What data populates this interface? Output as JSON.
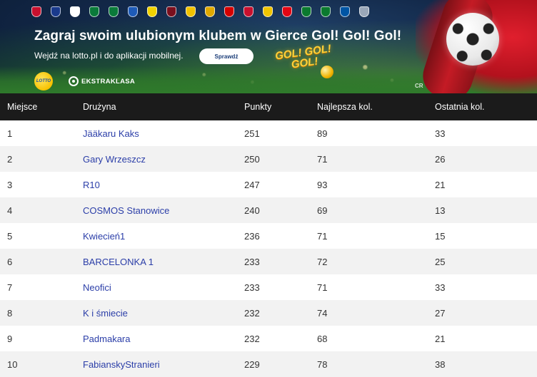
{
  "banner": {
    "headline": "Zagraj swoim ulubionym klubem w Gierce Gol! Gol! Gol!",
    "subline": "Wejdź na lotto.pl i do aplikacji mobilnej.",
    "cta_label": "Sprawdź",
    "lotto_label": "LOTTO",
    "ekstraklasa_label": "EKSTRAKLASA",
    "game_logo_line1": "GOL! GOL!",
    "game_logo_line2": "GOL!",
    "corner_mark": "CR",
    "club_crest_colors": [
      "#c8102e",
      "#1a3a8c",
      "#ffffff",
      "#0a7a3a",
      "#0a7a3a",
      "#1e5bb8",
      "#f2d300",
      "#7a0f1e",
      "#f2c200",
      "#e0a800",
      "#d50000",
      "#c8102e",
      "#f0c400",
      "#e30613",
      "#0b7a2f",
      "#0b7a2f",
      "#0055a4",
      "#9aa7b8"
    ]
  },
  "table": {
    "headers": {
      "position": "Miejsce",
      "team": "Drużyna",
      "points": "Punkty",
      "best_round": "Najlepsza kol.",
      "last_round": "Ostatnia kol."
    },
    "rows": [
      {
        "position": "1",
        "team": "Jääkaru Kaks",
        "points": "251",
        "best_round": "89",
        "last_round": "33"
      },
      {
        "position": "2",
        "team": "Gary Wrzeszcz",
        "points": "250",
        "best_round": "71",
        "last_round": "26"
      },
      {
        "position": "3",
        "team": "R10",
        "points": "247",
        "best_round": "93",
        "last_round": "21"
      },
      {
        "position": "4",
        "team": "COSMOS Stanowice",
        "points": "240",
        "best_round": "69",
        "last_round": "13"
      },
      {
        "position": "5",
        "team": "Kwiecień1",
        "points": "236",
        "best_round": "71",
        "last_round": "15"
      },
      {
        "position": "6",
        "team": "BARCELONKA 1",
        "points": "233",
        "best_round": "72",
        "last_round": "25"
      },
      {
        "position": "7",
        "team": "Neofici",
        "points": "233",
        "best_round": "71",
        "last_round": "33"
      },
      {
        "position": "8",
        "team": "K i śmiecie",
        "points": "232",
        "best_round": "74",
        "last_round": "27"
      },
      {
        "position": "9",
        "team": "Padmakara",
        "points": "232",
        "best_round": "68",
        "last_round": "21"
      },
      {
        "position": "10",
        "team": "FabianskyStranieri",
        "points": "229",
        "best_round": "78",
        "last_round": "38"
      }
    ],
    "colors": {
      "header_bg": "#1b1b1b",
      "stripe_bg": "#f2f2f2",
      "link": "#2b3ea8"
    }
  }
}
